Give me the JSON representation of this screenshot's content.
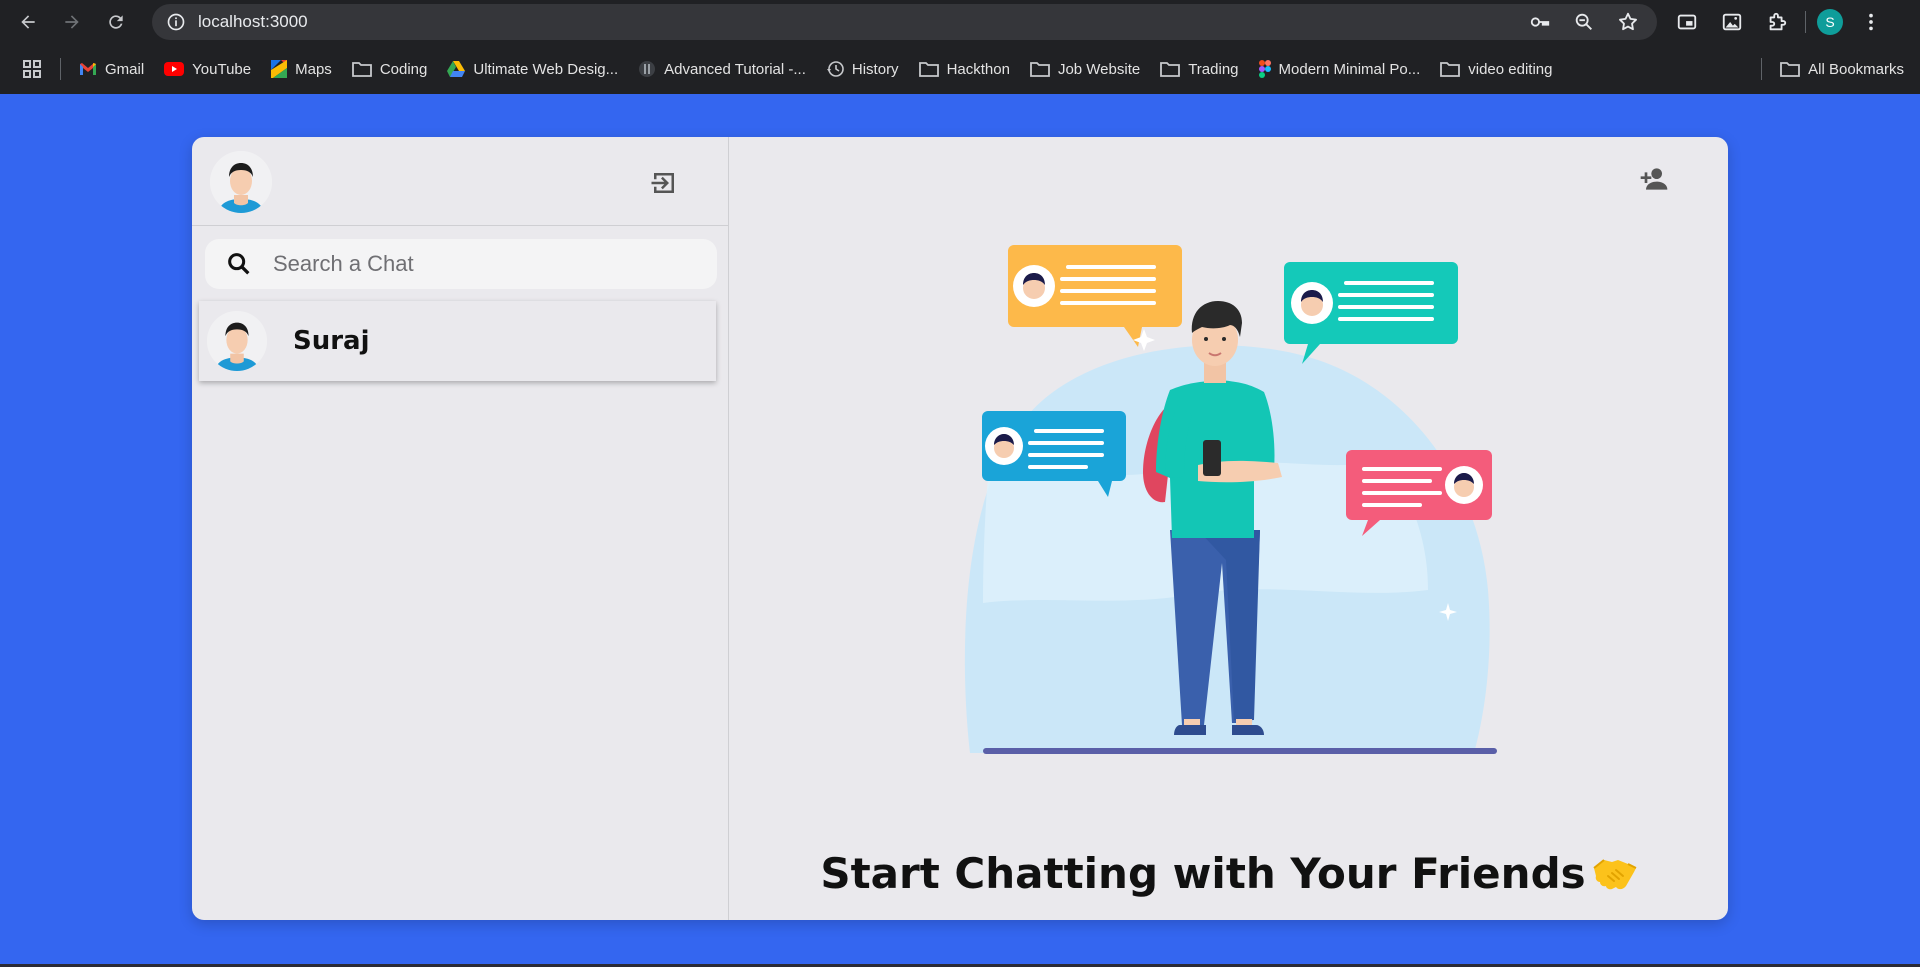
{
  "browser": {
    "url": "localhost:3000",
    "profile_initial": "S",
    "bookmarks": [
      {
        "label": "Gmail",
        "icon": "gmail-icon"
      },
      {
        "label": "YouTube",
        "icon": "youtube-icon"
      },
      {
        "label": "Maps",
        "icon": "maps-icon"
      },
      {
        "label": "Coding",
        "icon": "folder-icon"
      },
      {
        "label": "Ultimate Web Desig...",
        "icon": "drive-icon"
      },
      {
        "label": "Advanced Tutorial -...",
        "icon": "site-icon"
      },
      {
        "label": "History",
        "icon": "history-icon"
      },
      {
        "label": "Hackthon",
        "icon": "folder-icon"
      },
      {
        "label": "Job Website",
        "icon": "folder-icon"
      },
      {
        "label": "Trading",
        "icon": "folder-icon"
      },
      {
        "label": "Modern Minimal Po...",
        "icon": "figma-icon"
      },
      {
        "label": "video editing",
        "icon": "folder-icon"
      }
    ],
    "all_bookmarks_label": "All Bookmarks"
  },
  "sidebar": {
    "search_placeholder": "Search a Chat",
    "chats": [
      {
        "name": "Suraj"
      }
    ]
  },
  "main": {
    "welcome_text": "Start Chatting with Your Friends",
    "welcome_emoji": "handshake-emoji"
  },
  "colors": {
    "page_background": "#3466f0",
    "card_background": "#eae9ed",
    "browser_chrome": "#202124"
  }
}
